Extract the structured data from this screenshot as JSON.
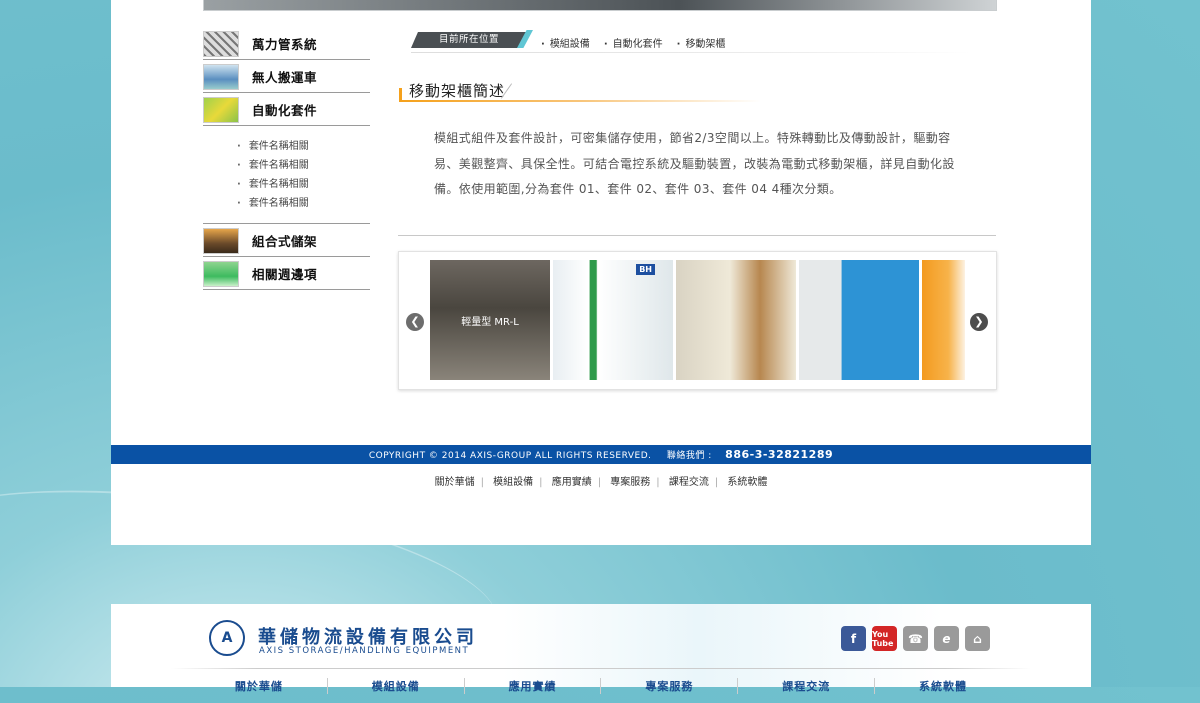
{
  "sidebar": {
    "categories": [
      {
        "label": "萬力管系統"
      },
      {
        "label": "無人搬運車"
      },
      {
        "label": "自動化套件"
      },
      {
        "label": "組合式儲架"
      },
      {
        "label": "相關週邊項"
      }
    ],
    "subitems": [
      "套件名稱相關",
      "套件名稱相關",
      "套件名稱相關",
      "套件名稱相關"
    ]
  },
  "breadcrumb": {
    "tag": "目前所在位置",
    "items": [
      "模組設備",
      "自動化套件",
      "移動架櫃"
    ]
  },
  "section": {
    "title": "移動架櫃簡述",
    "description": "模組式組件及套件設計，可密集儲存使用，節省2/3空間以上。特殊轉動比及傳動設計，驅動容易、美觀整齊、具保全性。可結合電控系統及驅動裝置，改裝為電動式移動架櫃，詳見自動化設備。依使用範圍,分為套件 01、套件 02、套件 03、套件 04  4種次分類。"
  },
  "carousel": {
    "slide1_caption": "輕量型 MR-L",
    "slide2_badge": "BH",
    "prev_icon": "chevron-left-icon",
    "next_icon": "chevron-right-icon"
  },
  "footer": {
    "copyright": "COPYRIGHT © 2014 AXIS-GROUP ALL RIGHTS RESERVED.",
    "contact_label": "聯絡我們 :",
    "phone": "886-3-32821289",
    "links": [
      "關於華儲",
      "模組設備",
      "應用實績",
      "專案服務",
      "課程交流",
      "系統軟體"
    ]
  },
  "brand": {
    "logo_mark": "A",
    "name_cn": "華儲物流設備有限公司",
    "name_en": "AXIS STORAGE/HANDLING EQUIPMENT",
    "social_icons": [
      "facebook-icon",
      "youtube-icon",
      "phone-icon",
      "epaper-icon",
      "home-icon"
    ],
    "yt_text": "You Tube",
    "fb_text": "f",
    "phone_text": "☎",
    "paper_text": "e",
    "home_text": "⌂",
    "nav": [
      "關於華儲",
      "模組設備",
      "應用實績",
      "專案服務",
      "課程交流",
      "系統軟體"
    ]
  },
  "colors": {
    "brand_blue": "#0a52a5",
    "accent_orange": "#f5a11c",
    "accent_teal": "#60c6d4"
  }
}
